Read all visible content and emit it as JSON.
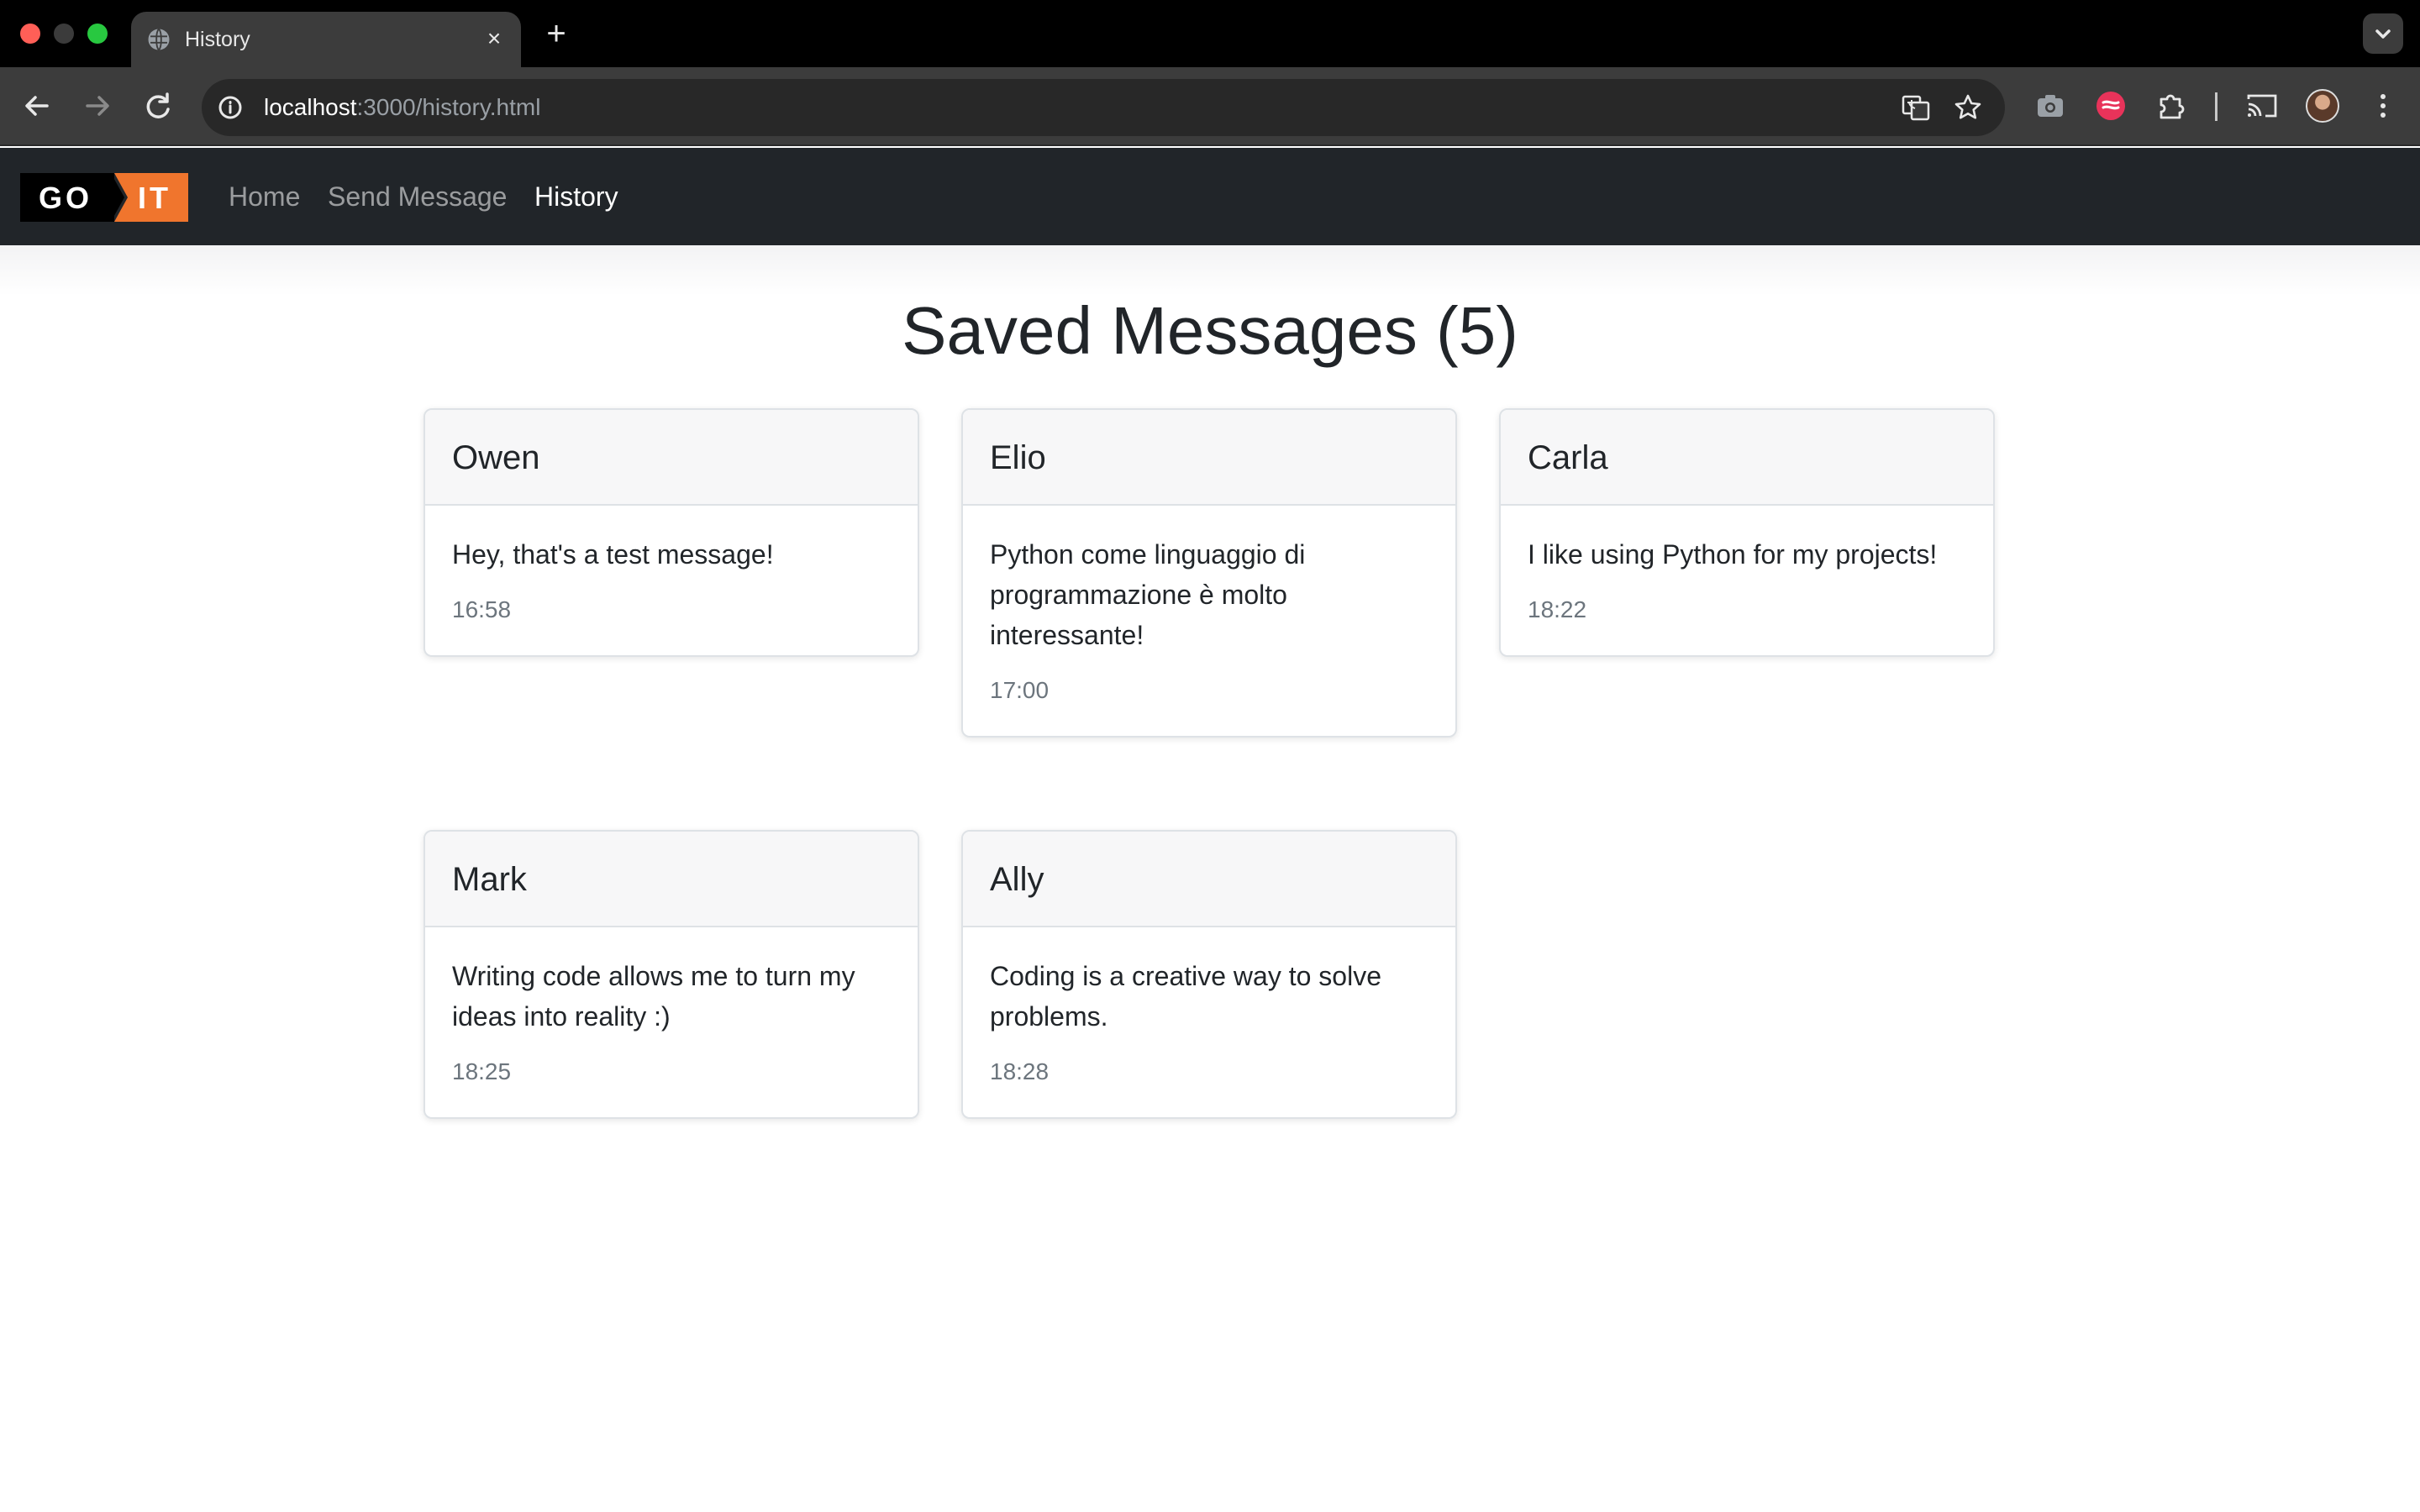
{
  "browser": {
    "tab_title": "History",
    "new_tab_glyph": "+",
    "close_glyph": "×",
    "url_host": "localhost",
    "url_rest": ":3000/history.html",
    "icons": [
      "globe-icon",
      "back-icon",
      "forward-icon",
      "reload-icon",
      "site-info-icon",
      "translate-icon",
      "bookmark-star-icon",
      "camera-extension-icon",
      "red-extension-icon",
      "puzzle-extensions-icon",
      "cast-icon",
      "profile-avatar",
      "more-menu-icon",
      "tab-search-icon"
    ]
  },
  "navbar": {
    "logo_left": "GO",
    "logo_right": "IT",
    "links": [
      {
        "label": "Home"
      },
      {
        "label": "Send Message"
      },
      {
        "label": "History"
      }
    ],
    "colors": {
      "background": "#212529",
      "logo_accent": "#f0752d"
    }
  },
  "page": {
    "title": "Saved Messages (5)"
  },
  "messages": [
    {
      "name": "Owen",
      "text": "Hey, that's a test message!",
      "time": "16:58"
    },
    {
      "name": "Elio",
      "text": "Python come linguaggio di programmazione è molto interessante!",
      "time": "17:00"
    },
    {
      "name": "Carla",
      "text": "I like using Python for my projects!",
      "time": "18:22"
    },
    {
      "name": "Mark",
      "text": "Writing code allows me to turn my ideas into reality :)",
      "time": "18:25"
    },
    {
      "name": "Ally",
      "text": "Coding is a creative way to solve problems.",
      "time": "18:28"
    }
  ]
}
